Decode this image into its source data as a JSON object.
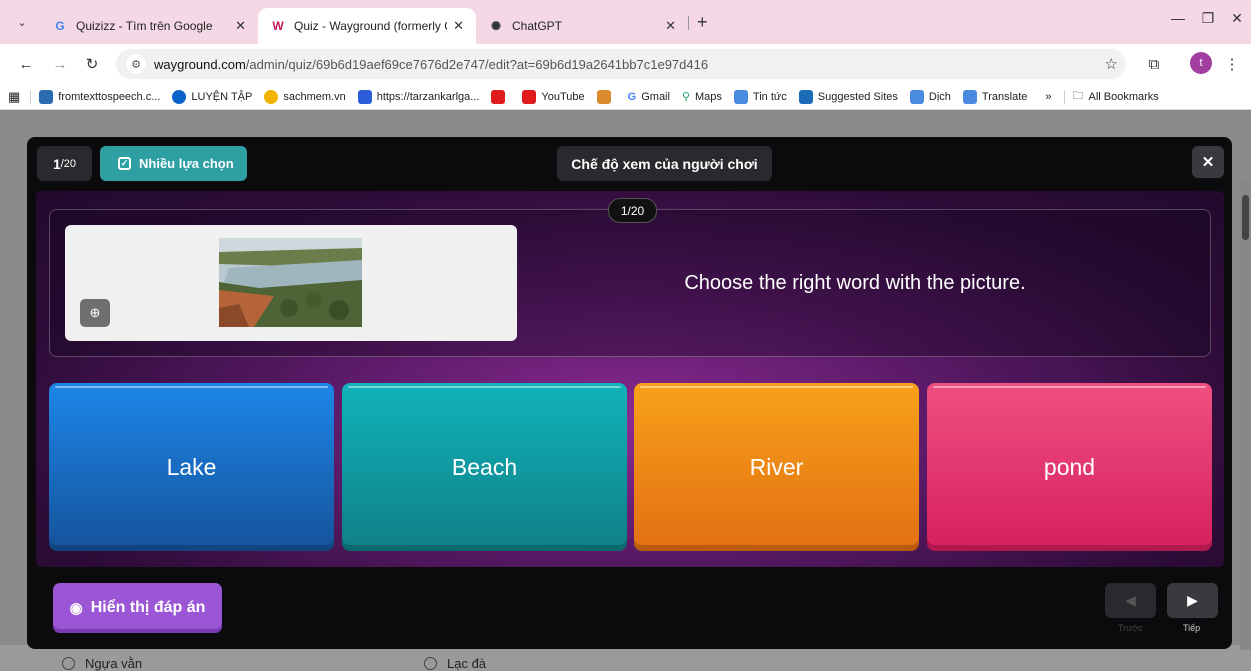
{
  "browser": {
    "tabs": [
      {
        "icon": "G",
        "title": "Quizizz - Tìm trên Google"
      },
      {
        "icon": "W",
        "title": "Quiz - Wayground (formerly Qu"
      },
      {
        "icon": "✺",
        "title": "ChatGPT"
      }
    ],
    "url_domain": "wayground.com",
    "url_path": "/admin/quiz/69b6d19aef69ce7676d2e747/edit?at=69b6d19a2641bb7c1e97d416",
    "profile_initial": "t",
    "bookmarks": [
      {
        "label": "fromtexttospeech.c...",
        "color": "#2b6cb0"
      },
      {
        "label": "LUYỆN TẬP",
        "color": "#0b63c9"
      },
      {
        "label": "sachmem.vn",
        "color": "#f2b400"
      },
      {
        "label": "https://tarzankarlga...",
        "color": "#2b5ed8"
      },
      {
        "label": "",
        "color": "#e01b1b"
      },
      {
        "label": "YouTube",
        "color": "#e01b1b"
      },
      {
        "label": "",
        "color": "#d98a2b"
      },
      {
        "label": "Gmail",
        "color": "#ffffff"
      },
      {
        "label": "Maps",
        "color": "#1fa463"
      },
      {
        "label": "Tin tức",
        "color": "#4a8be0"
      },
      {
        "label": "Suggested Sites",
        "color": "#1b6bb8"
      },
      {
        "label": "Dịch",
        "color": "#4a8be0"
      },
      {
        "label": "Translate",
        "color": "#4a8be0"
      }
    ],
    "bookmarks_overflow": "»",
    "all_bookmarks": "All Bookmarks"
  },
  "player": {
    "question_index": "1",
    "question_total": "/20",
    "question_type": "Nhiều lựa chọn",
    "view_mode": "Chế độ xem của người chơi",
    "badge": "1/20",
    "question_text": "Choose the right word with the picture.",
    "answers": [
      "Lake",
      "Beach",
      "River",
      "pond"
    ],
    "show_answer": "Hiển thị đáp án",
    "prev_label": "Trước",
    "next_label": "Tiếp"
  },
  "background": {
    "options": [
      "Ngựa vằn",
      "Lạc đà"
    ]
  },
  "colors": {
    "tabbar": "#f5d8e6",
    "type_badge": "#2e9fa3",
    "show_answer": "#9b56d6",
    "answer_blue": "#1d86e8",
    "answer_teal": "#11b3ba",
    "answer_orange": "#f8a11a",
    "answer_pink": "#ef5080"
  }
}
